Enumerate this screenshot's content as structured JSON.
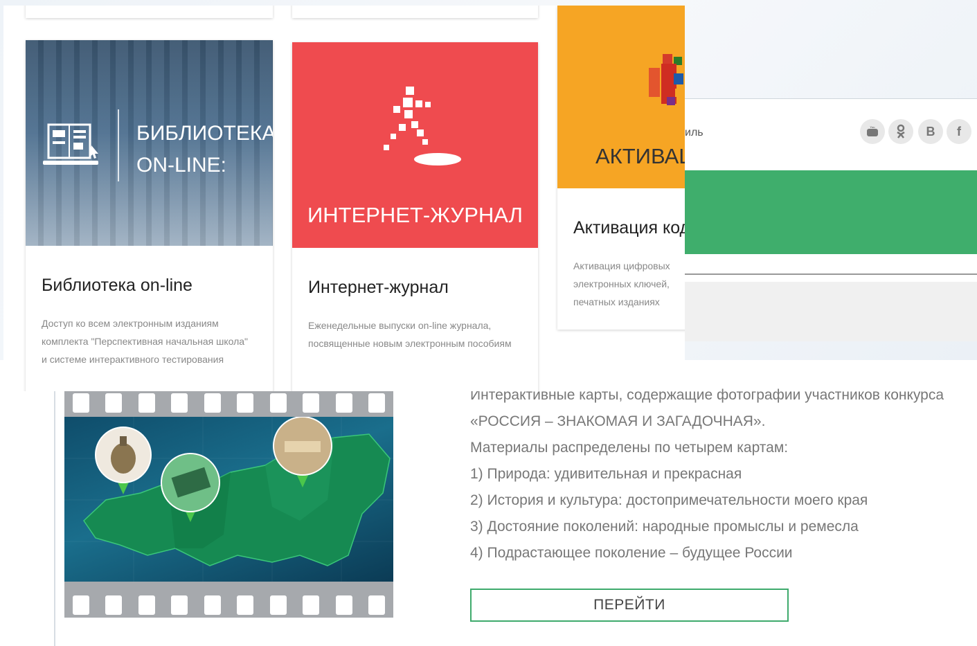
{
  "library_card": {
    "banner_line1": "БИБЛИОТЕКА",
    "banner_line2": "ON-LINE:",
    "title": "Библиотека on-line",
    "desc": "Доступ ко всем электронным изданиям комплекта \"Перспективная начальная школа\" и системе интерактивного тестирования",
    "icon": "ebook-reader-icon"
  },
  "journal_card": {
    "banner_text": "ИНТЕРНЕТ-ЖУРНАЛ",
    "title": "Интернет-журнал",
    "desc": "Еженедельные выпуски on-line журнала, посвященные новым электронным пособиям",
    "icon": "running-figure-icon"
  },
  "activation_card": {
    "banner_text": "АКТИВАЦ",
    "title": "Активация код",
    "desc_lines": [
      "Активация цифровых",
      "электронных ключей,",
      "печатных изданиях"
    ],
    "icon": "pixel-blocks-icon"
  },
  "side_window": {
    "partial_text": "иль",
    "social": [
      {
        "icon": "youtube-icon",
        "label": "▶"
      },
      {
        "icon": "odnoklassniki-icon",
        "label": "ok"
      },
      {
        "icon": "vk-icon",
        "label": "B"
      },
      {
        "icon": "facebook-icon",
        "label": "f"
      }
    ],
    "accent_green": "#3fae6c"
  },
  "map_section": {
    "lines": [
      "Интерактивные карты, содержащие фотографии участников конкурса",
      "«РОССИЯ – ЗНАКОМАЯ И ЗАГАДОЧНАЯ».",
      "Материалы распределены по четырем картам:",
      "1) Природа: удивительная и прекрасная",
      "2) История и культура: достопримечательности моего края",
      "3) Достояние поколений: народные промыслы и ремесла",
      "4) Подрастающее поколение – будущее России"
    ],
    "button_label": "ПЕРЕЙТИ",
    "button_border": "#3eaa6c"
  }
}
